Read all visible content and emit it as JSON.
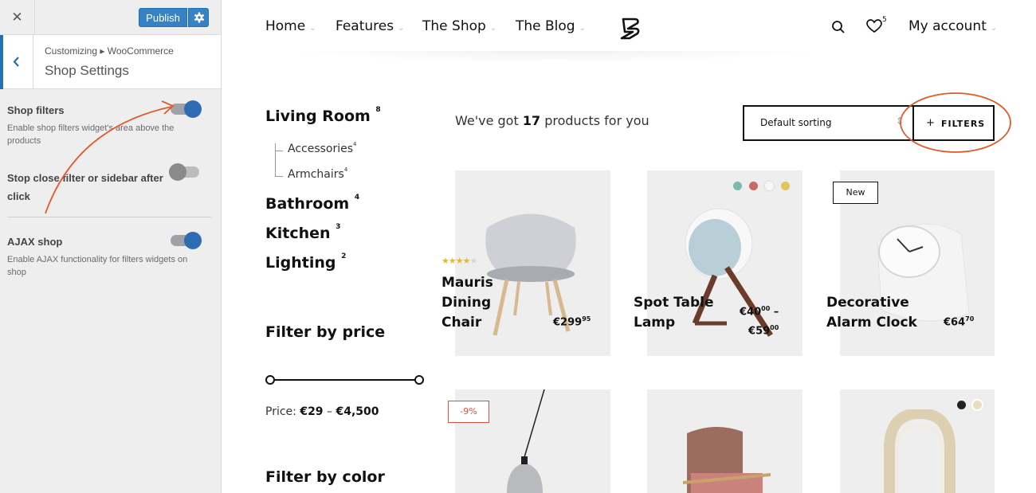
{
  "customizer": {
    "close_icon": "close-icon",
    "publish_label": "Publish",
    "gear_icon": "gear-icon",
    "breadcrumb": "Customizing ▸ WooCommerce",
    "section_title": "Shop Settings",
    "settings": [
      {
        "label": "Shop filters",
        "description": "Enable shop filters widget's area above the products",
        "enabled": true
      },
      {
        "label": "Stop close filter or sidebar after click",
        "description": "",
        "enabled": false
      },
      {
        "label": "AJAX shop",
        "description": "Enable AJAX functionality for filters widgets on shop",
        "enabled": true
      }
    ],
    "colors": {
      "accent": "#3582c4",
      "annotation": "#e05a2b"
    }
  },
  "header": {
    "nav": [
      "Home",
      "Features",
      "The Shop",
      "The Blog"
    ],
    "logo_icon": "brand-logo-icon",
    "search_icon": "search-icon",
    "wishlist_icon": "heart-icon",
    "wishlist_count": "5",
    "account_label": "My account"
  },
  "sidebar": {
    "categories": [
      {
        "name": "Living Room",
        "count": "8",
        "children": [
          {
            "name": "Accessories",
            "count": "4"
          },
          {
            "name": "Armchairs",
            "count": "4"
          }
        ]
      },
      {
        "name": "Bathroom",
        "count": "4"
      },
      {
        "name": "Kitchen",
        "count": "3"
      },
      {
        "name": "Lighting",
        "count": "2"
      }
    ],
    "price_title": "Filter by price",
    "price_label": "Price:",
    "price_min": "€29",
    "price_sep": "–",
    "price_max": "€4,500",
    "color_title": "Filter by color"
  },
  "results": {
    "prefix": "We've got",
    "count": "17",
    "suffix": "products for you",
    "sorting": "Default sorting",
    "filters_label": "FILTERS"
  },
  "products": [
    {
      "name_lines": [
        "Mauris",
        "Dining",
        "Chair"
      ],
      "price": "€299",
      "cents": "95",
      "rating": 3.5,
      "badge": ""
    },
    {
      "name_lines": [
        "Spot Table",
        "Lamp"
      ],
      "price": "€40",
      "cents": "00",
      "price2": "€59",
      "cents2": "00",
      "colors": [
        "#7fb8ad",
        "#c96a63",
        "#f5f5f5",
        "#e2c45a"
      ],
      "badge": ""
    },
    {
      "name_lines": [
        "Decorative",
        "Alarm Clock"
      ],
      "price": "€64",
      "cents": "70",
      "badge": "New"
    },
    {
      "badge": "-9%"
    },
    {
      "badge": ""
    },
    {
      "colors": [
        "#222222",
        "#e9dcc0"
      ],
      "badge": ""
    }
  ]
}
